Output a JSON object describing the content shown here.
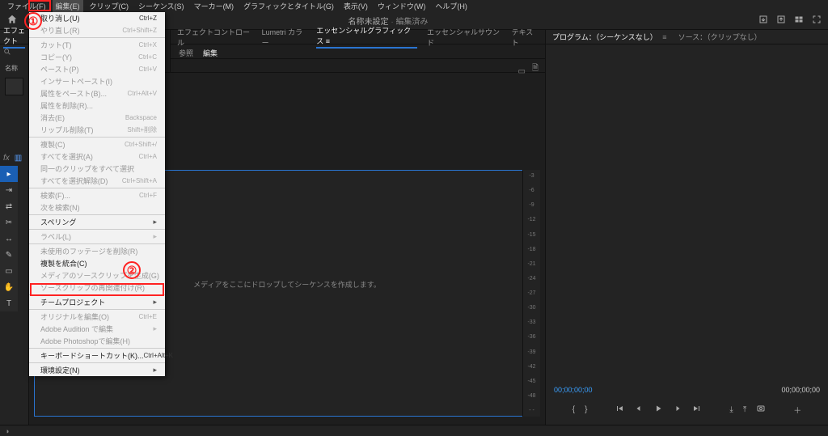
{
  "menubar": [
    {
      "label": "ファイル(F)"
    },
    {
      "label": "編集(E)",
      "active": true
    },
    {
      "label": "クリップ(C)"
    },
    {
      "label": "シーケンス(S)"
    },
    {
      "label": "マーカー(M)"
    },
    {
      "label": "グラフィックとタイトル(G)"
    },
    {
      "label": "表示(V)"
    },
    {
      "label": "ウィンドウ(W)"
    },
    {
      "label": "ヘルプ(H)"
    }
  ],
  "header": {
    "title_left": "名称未設定",
    "title_right": "編集済み"
  },
  "left_panel": {
    "tab": "エフェクト",
    "stub_label": "名称"
  },
  "midtop_tabs": [
    {
      "label": "エフェクトコントロール"
    },
    {
      "label": "Lumetri カラー"
    },
    {
      "label": "エッセンシャルグラフィックス",
      "active": true,
      "suffix": "≡"
    },
    {
      "label": "エッセンシャルサウンド"
    },
    {
      "label": "テキスト"
    }
  ],
  "midtop_subtabs": [
    {
      "label": "参照"
    },
    {
      "label": "編集",
      "active": true
    }
  ],
  "timeline": {
    "msg": "メディアをここにドロップしてシーケンスを作成します。"
  },
  "level_ticks": [
    "-3",
    "-6",
    "-9",
    "-12",
    "-15",
    "-18",
    "-21",
    "-24",
    "-27",
    "-30",
    "-33",
    "-36",
    "-39",
    "-42",
    "-45",
    "-48",
    "- -"
  ],
  "program_tabs": {
    "a": "プログラム：（シーケンスなし）",
    "a_suffix": "≡",
    "b": "ソース：（クリップなし）"
  },
  "timecodes": {
    "left": "00;00;00;00",
    "right": "00;00;00;00"
  },
  "annotations": {
    "one": "①",
    "two": "②"
  },
  "status_icon": "◑",
  "fx_label": "fx",
  "edit_menu": [
    {
      "label": "取り消し(U)",
      "sc": "Ctrl+Z"
    },
    {
      "label": "やり直し(R)",
      "sc": "Ctrl+Shift+Z",
      "disabled": true
    },
    {
      "sep": true
    },
    {
      "label": "カット(T)",
      "sc": "Ctrl+X",
      "disabled": true
    },
    {
      "label": "コピー(Y)",
      "sc": "Ctrl+C",
      "disabled": true
    },
    {
      "label": "ペースト(P)",
      "sc": "Ctrl+V",
      "disabled": true
    },
    {
      "label": "インサートペースト(I)",
      "disabled": true
    },
    {
      "label": "属性をペースト(B)...",
      "sc": "Ctrl+Alt+V",
      "disabled": true
    },
    {
      "label": "属性を削除(R)...",
      "disabled": true
    },
    {
      "label": "消去(E)",
      "sc": "Backspace",
      "disabled": true
    },
    {
      "label": "リップル削除(T)",
      "sc": "Shift+削除",
      "disabled": true
    },
    {
      "sep": true
    },
    {
      "label": "複製(C)",
      "sc": "Ctrl+Shift+/",
      "disabled": true
    },
    {
      "label": "すべてを選択(A)",
      "sc": "Ctrl+A",
      "disabled": true
    },
    {
      "label": "同一のクリップをすべて選択",
      "disabled": true
    },
    {
      "label": "すべてを選択解除(D)",
      "sc": "Ctrl+Shift+A",
      "disabled": true
    },
    {
      "sep": true
    },
    {
      "label": "検索(F)...",
      "sc": "Ctrl+F",
      "disabled": true
    },
    {
      "label": "次を検索(N)",
      "disabled": true
    },
    {
      "sep": true
    },
    {
      "label": "スペリング",
      "submenu": true
    },
    {
      "sep": true
    },
    {
      "label": "ラベル(L)",
      "submenu": true,
      "disabled": true
    },
    {
      "sep": true
    },
    {
      "label": "未使用のフッテージを削除(R)",
      "disabled": true
    },
    {
      "label": "複製を統合(C)"
    },
    {
      "label": "メディアのソースクリップを生成(G)",
      "disabled": true
    },
    {
      "label": "ソースクリップの再関連付け(R)",
      "disabled": true
    },
    {
      "sep": true
    },
    {
      "label": "チームプロジェクト",
      "submenu": true
    },
    {
      "sep": true
    },
    {
      "label": "オリジナルを編集(O)",
      "sc": "Ctrl+E",
      "disabled": true
    },
    {
      "label": "Adobe Audition で編集",
      "submenu": true,
      "disabled": true
    },
    {
      "label": "Adobe Photoshopで編集(H)",
      "disabled": true
    },
    {
      "sep": true
    },
    {
      "label": "キーボードショートカット(K)...",
      "sc": "Ctrl+Alt+K"
    },
    {
      "sep": true
    },
    {
      "label": "環境設定(N)",
      "submenu": true
    }
  ]
}
